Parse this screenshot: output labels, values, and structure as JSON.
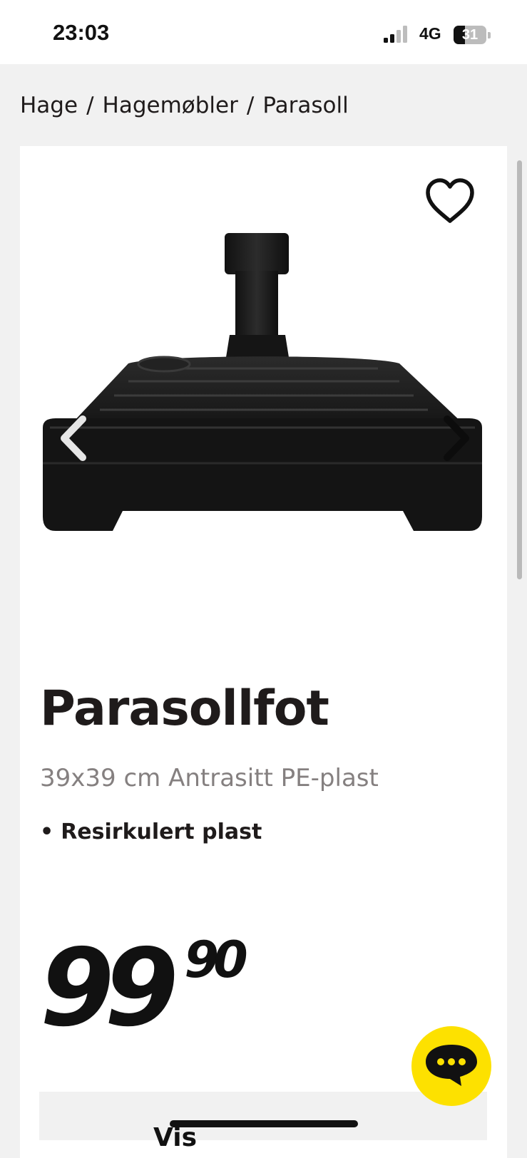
{
  "status_bar": {
    "time": "23:03",
    "network": "4G",
    "battery_level": "31",
    "icons": [
      "signal-icon",
      "battery-icon"
    ]
  },
  "breadcrumb": {
    "items": [
      "Hage",
      "Hagemøbler",
      "Parasoll"
    ],
    "separator": "/"
  },
  "product": {
    "title": "Parasollfot",
    "subtitle": "39x39 cm Antrasitt PE-plast",
    "feature_bullet": "•",
    "feature": "Resirkulert plast",
    "price_main": "99",
    "price_cents": "90",
    "image_icon": "parasol-base-image"
  },
  "actions": {
    "favorite_icon": "heart-icon",
    "carousel_prev_icon": "chevron-left-icon",
    "carousel_next_icon": "chevron-right-icon",
    "chat_icon": "chat-bubble-icon",
    "chat_button_color": "#fde100"
  },
  "bottom_panel": {
    "label": "Vis"
  }
}
